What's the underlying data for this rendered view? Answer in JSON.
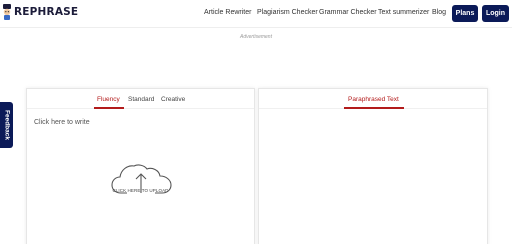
{
  "header": {
    "logo_text": "REPHRASE",
    "nav": [
      {
        "label": "Article Rewriter"
      },
      {
        "label": "Plagiarism Checker"
      },
      {
        "label": "Grammar Checker"
      },
      {
        "label": "Text summerizer"
      },
      {
        "label": "Blog"
      }
    ],
    "plans_label": "Plans",
    "login_label": "Login",
    "button_color": "#0b1a58"
  },
  "ad_label": "Advertisement",
  "feedback_label": "Feedback",
  "editor": {
    "tabs": [
      {
        "label": "Fluency",
        "active": true
      },
      {
        "label": "Standard",
        "active": false
      },
      {
        "label": "Creative",
        "active": false
      }
    ],
    "placeholder": "Click here to write",
    "upload_label": "CLICK HERE TO UPLOAD",
    "upload_icon": "cloud-upload-icon"
  },
  "output": {
    "tab_label": "Paraphrased Text"
  },
  "accent_color": "#b31b1b"
}
